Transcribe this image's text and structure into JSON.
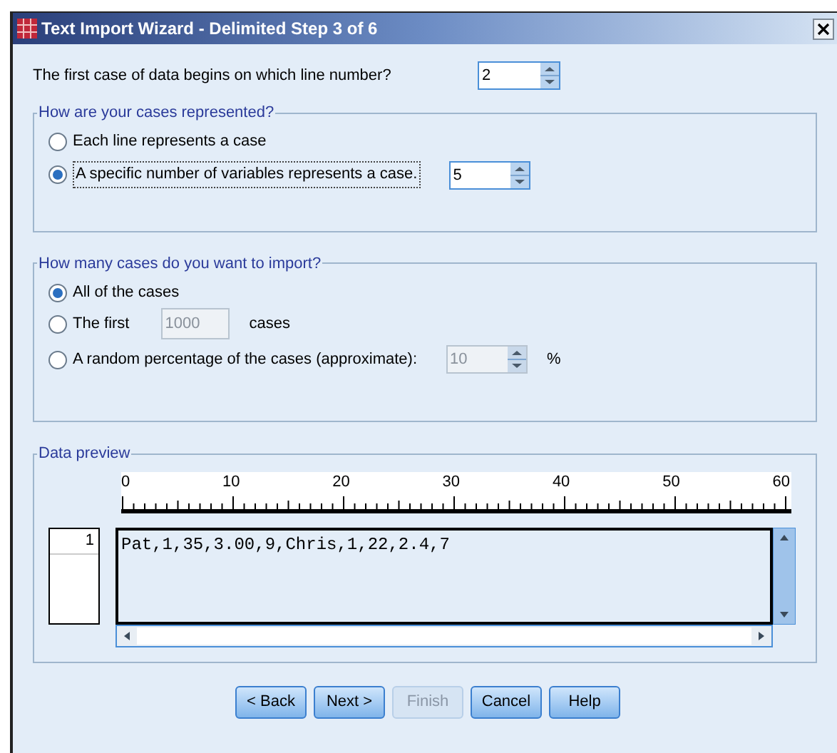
{
  "window": {
    "title": "Text Import Wizard - Delimited Step 3 of 6"
  },
  "first_line": {
    "label": "The first case of data begins on which line number?",
    "value": "2"
  },
  "cases_represented": {
    "legend": "How are your cases represented?",
    "options": [
      {
        "kind": "plain",
        "label": "Each line represents a case",
        "selected": false
      },
      {
        "kind": "spin",
        "label": "A specific number of variables represents a case.",
        "selected": true,
        "value": "5",
        "disabled": false
      }
    ]
  },
  "how_many": {
    "legend": "How many cases do you want to import?",
    "options": [
      {
        "kind": "plain",
        "label": "All of the cases",
        "selected": true
      },
      {
        "kind": "count",
        "label": "The first",
        "selected": false,
        "value": "1000",
        "disabled": true,
        "suffix": "cases"
      },
      {
        "kind": "spin",
        "label": "A random percentage of the cases (approximate):",
        "selected": false,
        "value": "10",
        "disabled": true,
        "suffix": "%"
      }
    ]
  },
  "preview": {
    "legend": "Data preview",
    "ruler_labels": [
      "0",
      "10",
      "20",
      "30",
      "40",
      "50",
      "60"
    ],
    "rows": [
      {
        "number": "1",
        "text": "Pat,1,35,3.00,9,Chris,1,22,2.4,7"
      }
    ]
  },
  "buttons": [
    {
      "label": "< Back",
      "disabled": false
    },
    {
      "label": "Next >",
      "disabled": false
    },
    {
      "label": "Finish",
      "disabled": true
    },
    {
      "label": "Cancel",
      "disabled": false
    },
    {
      "label": "Help",
      "disabled": false
    }
  ]
}
